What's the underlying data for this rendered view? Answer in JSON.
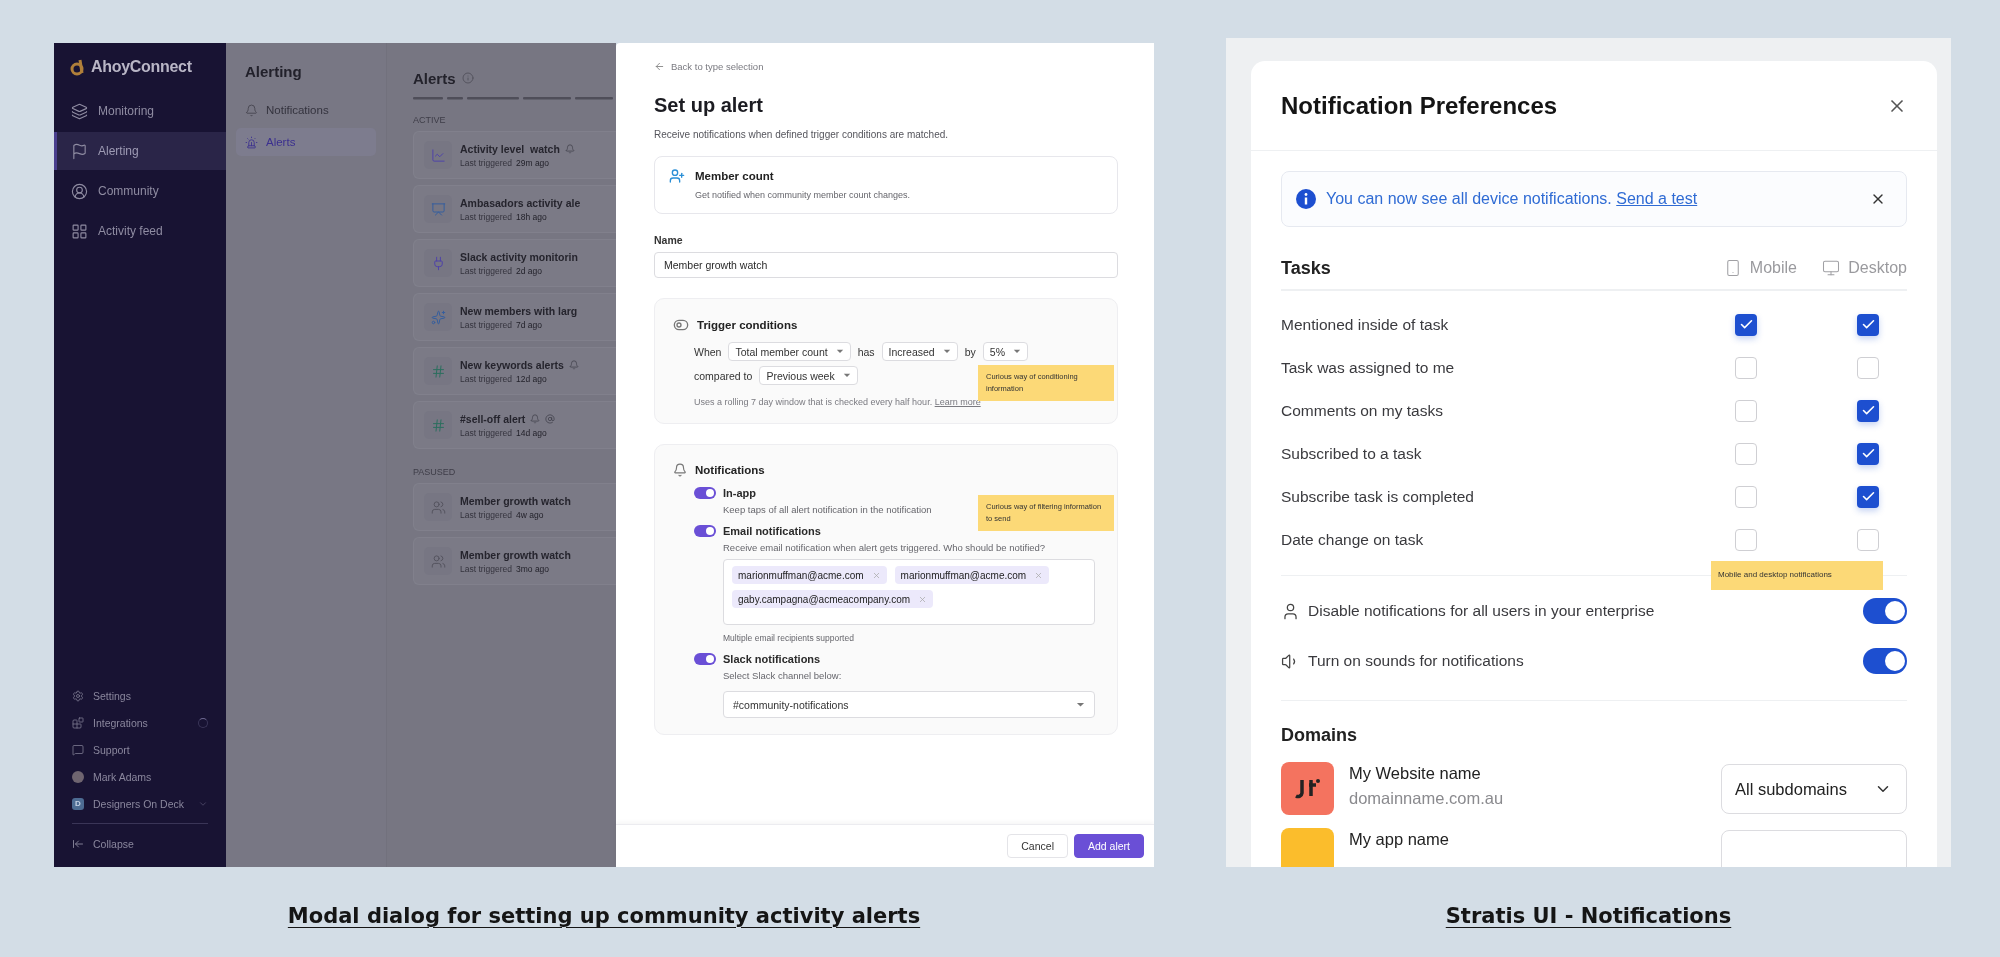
{
  "alert_showcase": {
    "sidebar": {
      "brand": "AhoyConnect",
      "items": [
        {
          "label": "Monitoring",
          "selected": false
        },
        {
          "label": "Alerting",
          "selected": true
        },
        {
          "label": "Community",
          "selected": false
        },
        {
          "label": "Activity feed",
          "selected": false
        }
      ],
      "footer_items": [
        {
          "kind": "link",
          "label": "Settings",
          "loading": false
        },
        {
          "kind": "link",
          "label": "Integrations",
          "loading": true
        },
        {
          "kind": "link",
          "label": "Support",
          "loading": false
        },
        {
          "kind": "user",
          "label": "Mark Adams",
          "loading": false
        },
        {
          "kind": "workspace",
          "label": "Designers On Deck",
          "initial": "D",
          "loading": false
        }
      ],
      "collapse": "Collapse"
    },
    "nav": {
      "title": "Alerting",
      "items": [
        {
          "label": "Notifications",
          "selected": false
        },
        {
          "label": "Alerts",
          "selected": true
        }
      ]
    },
    "alerts": {
      "title": "Alerts",
      "groups": [
        {
          "label": "ACTIVE",
          "items": [
            {
              "title": "Activity level  watch",
              "label": "Last triggered",
              "time": "29m ago",
              "bell": true,
              "mention": false
            },
            {
              "title": "Ambasadors activity ale",
              "label": "Last triggered",
              "time": "18h ago",
              "bell": false,
              "mention": false
            },
            {
              "title": "Slack activity monitorin",
              "label": "Last triggered",
              "time": "2d ago",
              "bell": false,
              "mention": false
            },
            {
              "title": "New members with larg",
              "label": "Last triggered",
              "time": "7d ago",
              "bell": false,
              "mention": false
            },
            {
              "title": "New keywords alerts",
              "label": "Last triggered",
              "time": "12d ago",
              "bell": true,
              "mention": false
            },
            {
              "title": "#sell-off alert",
              "label": "Last triggered",
              "time": "14d ago",
              "bell": true,
              "mention": true
            }
          ]
        },
        {
          "label": "PASUSED",
          "items": [
            {
              "title": "Member growth watch",
              "label": "Last triggered",
              "time": "4w ago",
              "bell": false,
              "mention": false
            },
            {
              "title": "Member growth watch",
              "label": "Last triggered",
              "time": "3mo ago",
              "bell": false,
              "mention": false
            }
          ]
        }
      ]
    },
    "modal": {
      "back": "Back to type selection",
      "title": "Set up alert",
      "description": "Receive notifications when defined trigger conditions are matched.",
      "type_card": {
        "title": "Member count",
        "description": "Get notified when community member count changes."
      },
      "name_field": {
        "label": "Name",
        "value": "Member growth watch"
      },
      "trigger": {
        "title": "Trigger conditions",
        "rows": [
          [
            {
              "kind": "text",
              "text": "When"
            },
            {
              "kind": "select",
              "value": "Total member count"
            },
            {
              "kind": "text",
              "text": "has"
            },
            {
              "kind": "select",
              "value": "Increased"
            },
            {
              "kind": "text",
              "text": "by"
            },
            {
              "kind": "select",
              "value": "5%"
            }
          ],
          [
            {
              "kind": "text",
              "text": "compared to"
            },
            {
              "kind": "select",
              "value": "Previous week"
            }
          ]
        ],
        "note": "Uses a rolling 7 day window that is checked every half hour.",
        "link": "Learn more",
        "annotation": "Curious way of conditioning information"
      },
      "notifications": {
        "title": "Notifications",
        "annotation": "Curious way of filtering information to send",
        "channels": [
          {
            "kind": "plain",
            "label": "In-app",
            "on": true,
            "description": "Keep taps of all alert notification in the notification"
          },
          {
            "kind": "email",
            "label": "Email notifications",
            "on": true,
            "description": "Receive email notification when alert gets triggered. Who should be notified?",
            "recipients": [
              "marionmuffman@acme.com",
              "marionmuffman@acme.com",
              "gaby.campagna@acmeacompany.com"
            ],
            "hint": "Multiple email recipients supported"
          },
          {
            "kind": "slack",
            "label": "Slack notifications",
            "on": true,
            "description": "Select Slack channel below:",
            "channel": "#community-notifications"
          }
        ]
      },
      "buttons": [
        {
          "kind": "secondary",
          "label": "Cancel"
        },
        {
          "kind": "primary",
          "label": "Add alert"
        }
      ]
    },
    "caption": "Modal dialog for setting up community activity alerts"
  },
  "preferences_showcase": {
    "title": "Notification Preferences",
    "banner": {
      "text": "You can now see all device notifications.",
      "link": "Send a test"
    },
    "tasks": {
      "title": "Tasks",
      "columns": [
        "Mobile",
        "Desktop"
      ],
      "rows": [
        {
          "label": "Mentioned inside of task",
          "mobile": true,
          "desktop": true
        },
        {
          "label": "Task was assigned to me",
          "mobile": false,
          "desktop": false
        },
        {
          "label": "Comments on my tasks",
          "mobile": false,
          "desktop": true
        },
        {
          "label": "Subscribed to a task",
          "mobile": false,
          "desktop": true
        },
        {
          "label": "Subscribe task is completed",
          "mobile": false,
          "desktop": true
        },
        {
          "label": "Date change on task",
          "mobile": false,
          "desktop": false
        }
      ]
    },
    "annotation": "Mobile and desktop notifications",
    "settings": [
      {
        "label": "Disable notifications for all users in your enterprise",
        "on": true
      },
      {
        "label": "Turn on sounds for notifications",
        "on": true
      }
    ],
    "domains": {
      "title": "Domains",
      "items": [
        {
          "name": "My Website name",
          "url": "domainname.com.au",
          "scope": "All subdomains",
          "color": "#f4735f"
        },
        {
          "name": "My app name",
          "color": "#fbbd2c"
        }
      ]
    },
    "caption": "Stratis UI - Notifications"
  }
}
